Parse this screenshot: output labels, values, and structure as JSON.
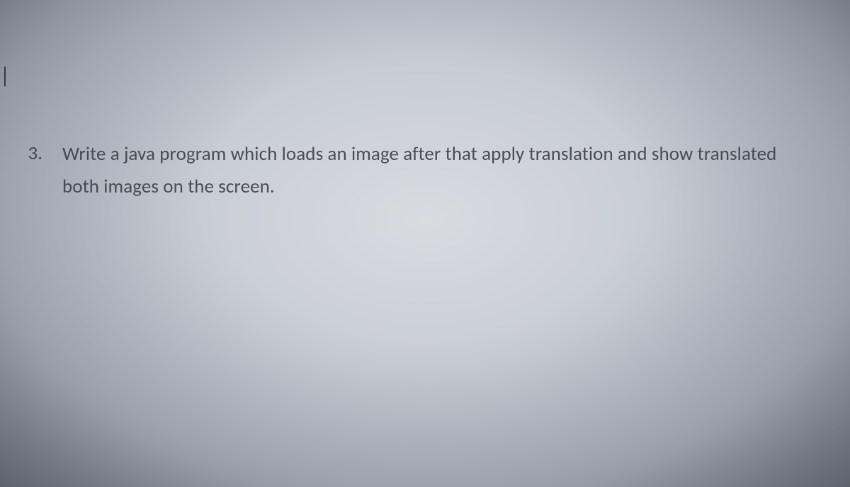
{
  "question": {
    "number": "3.",
    "text": "Write a java program which loads an image after that apply translation and show translated both images on the screen."
  }
}
